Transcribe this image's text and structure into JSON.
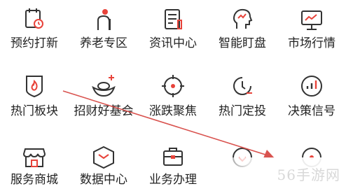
{
  "menu": {
    "row1": [
      {
        "label": "预约打新",
        "icon": "calendar-clock-icon"
      },
      {
        "label": "养老专区",
        "icon": "elder-person-icon"
      },
      {
        "label": "资讯中心",
        "icon": "news-document-icon"
      },
      {
        "label": "智能盯盘",
        "icon": "smart-brain-icon"
      },
      {
        "label": "市场行情",
        "icon": "market-monitor-icon"
      }
    ],
    "row2": [
      {
        "label": "热门板块",
        "icon": "hot-shield-icon"
      },
      {
        "label": "招财好基会",
        "icon": "gold-ingot-icon"
      },
      {
        "label": "涨跌聚焦",
        "icon": "focus-target-icon"
      },
      {
        "label": "热门定投",
        "icon": "timer-invest-icon"
      },
      {
        "label": "决策信号",
        "icon": "signal-bars-icon"
      }
    ],
    "row3": [
      {
        "label": "服务商城",
        "icon": "store-icon"
      },
      {
        "label": "数据中心",
        "icon": "data-box-icon"
      },
      {
        "label": "业务办理",
        "icon": "briefcase-icon"
      },
      {
        "label": "",
        "icon": "circle-icon"
      },
      {
        "label": "",
        "icon": "circle-icon"
      }
    ]
  },
  "watermark": {
    "text": "56手游网"
  },
  "colors": {
    "accent": "#e8433a",
    "icon_stroke": "#333333",
    "arrow": "#d9534f"
  }
}
